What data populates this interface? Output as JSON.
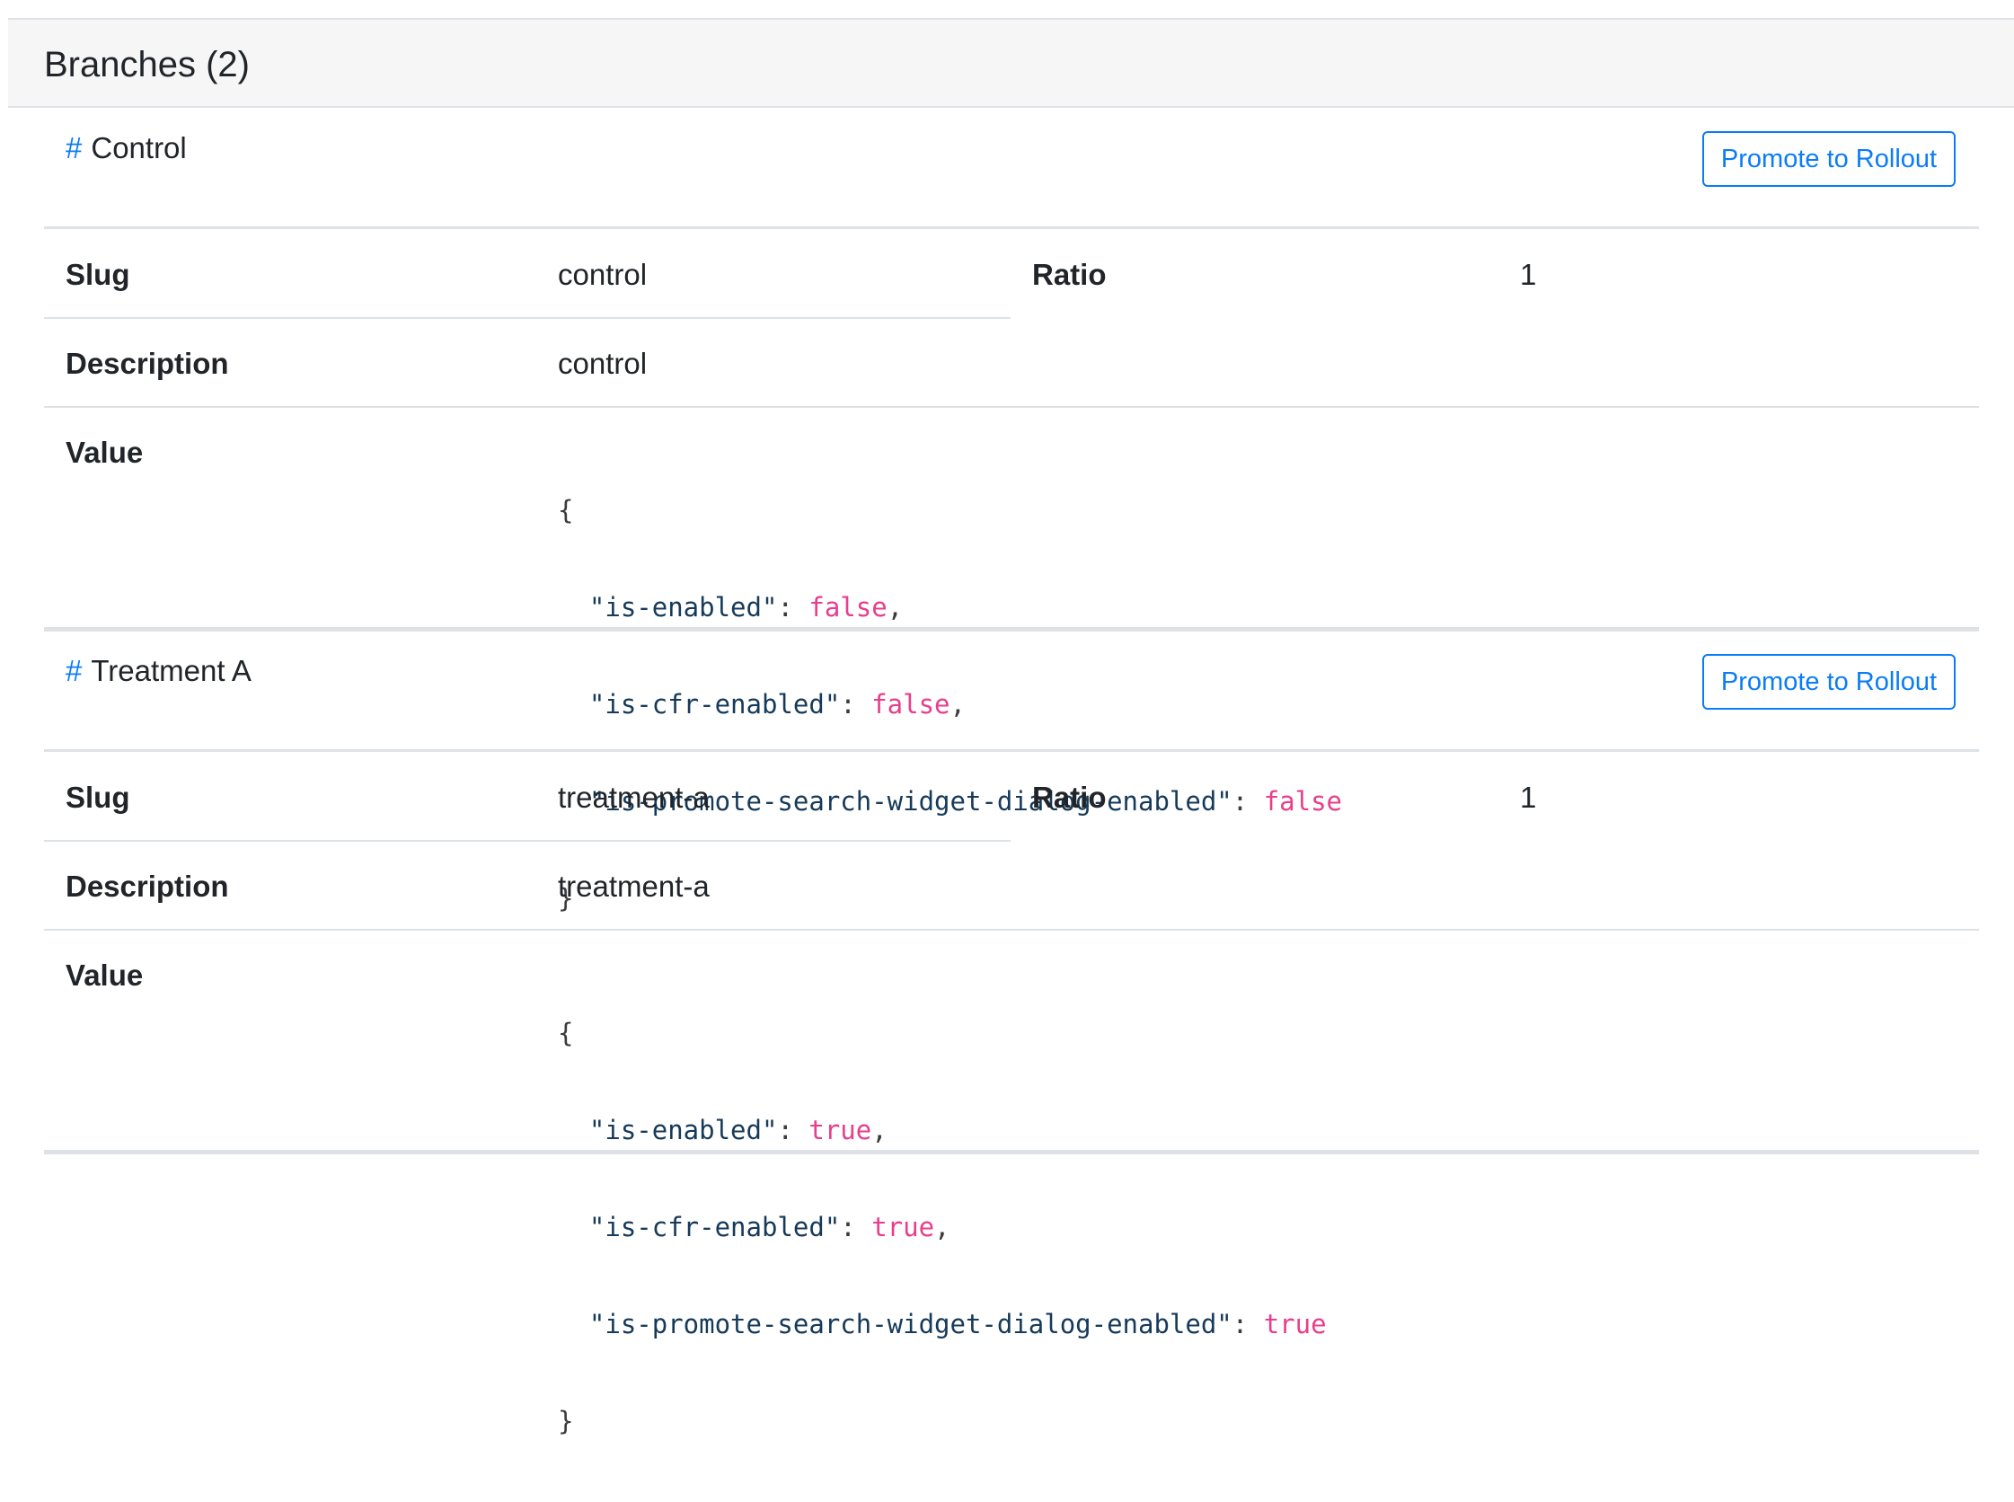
{
  "card": {
    "title": "Branches (2)"
  },
  "labels": {
    "slug": "Slug",
    "ratio": "Ratio",
    "description": "Description",
    "value": "Value"
  },
  "promote_label": "Promote to Rollout",
  "hash": "#",
  "branches": [
    {
      "name": "Control",
      "slug": "control",
      "ratio": "1",
      "description": "control",
      "value": {
        "open": "{",
        "close": "}",
        "lines": [
          {
            "key": "\"is-enabled\"",
            "val": "false",
            "sep": ","
          },
          {
            "key": "\"is-cfr-enabled\"",
            "val": "false",
            "sep": ","
          },
          {
            "key": "\"is-promote-search-widget-dialog-enabled\"",
            "val": "false",
            "sep": ""
          }
        ]
      }
    },
    {
      "name": "Treatment A",
      "slug": "treatment-a",
      "ratio": "1",
      "description": "treatment-a",
      "value": {
        "open": "{",
        "close": "}",
        "lines": [
          {
            "key": "\"is-enabled\"",
            "val": "true",
            "sep": ","
          },
          {
            "key": "\"is-cfr-enabled\"",
            "val": "true",
            "sep": ","
          },
          {
            "key": "\"is-promote-search-widget-dialog-enabled\"",
            "val": "true",
            "sep": ""
          }
        ]
      }
    }
  ],
  "colors": {
    "accent": "#0a7cf7",
    "boolean": "#e83e8c",
    "json_key": "#163a5a",
    "border": "#dee2e6",
    "header_bg": "#f6f6f6"
  }
}
